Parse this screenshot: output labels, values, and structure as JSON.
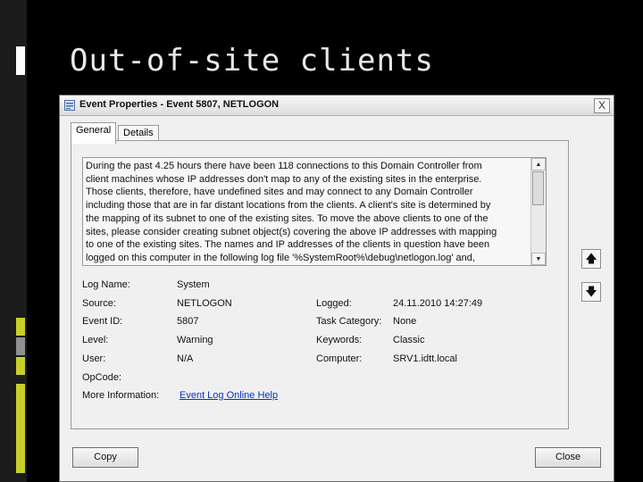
{
  "slide": {
    "title": "Out-of-site clients",
    "accent_colors": [
      "#c8cf2a",
      "#909090"
    ]
  },
  "dialog": {
    "title": "Event Properties - Event 5807, NETLOGON",
    "close_glyph": "X",
    "tabs": [
      {
        "label": "General"
      },
      {
        "label": "Details"
      }
    ],
    "description": [
      "During the past 4.25 hours there have been 118 connections to this Domain Controller from",
      "client machines whose IP addresses don't map to any of the existing sites in the enterprise.",
      "Those clients, therefore, have undefined sites and may connect to any Domain Controller",
      "including those that are in far distant locations from the clients. A client's site is determined by",
      "the mapping of its subnet to one of the existing sites. To move the above clients to one of the",
      "sites, please consider creating subnet object(s) covering the above IP addresses with mapping",
      "to one of the existing sites.  The names and IP addresses of the clients in question have been",
      "logged on this computer in the following log file '%SystemRoot%\\debug\\netlogon.log' and,"
    ],
    "fields": {
      "log_name_label": "Log Name:",
      "log_name": "System",
      "source_label": "Source:",
      "source": "NETLOGON",
      "logged_label": "Logged:",
      "logged": "24.11.2010 14:27:49",
      "event_id_label": "Event ID:",
      "event_id": "5807",
      "task_category_label": "Task Category:",
      "task_category": "None",
      "level_label": "Level:",
      "level": "Warning",
      "keywords_label": "Keywords:",
      "keywords": "Classic",
      "user_label": "User:",
      "user": "N/A",
      "computer_label": "Computer:",
      "computer": "SRV1.idtt.local",
      "opcode_label": "OpCode:",
      "opcode": "",
      "more_info_label": "More Information:",
      "more_info_link": "Event Log Online Help"
    },
    "buttons": {
      "copy": "Copy",
      "close": "Close"
    }
  }
}
